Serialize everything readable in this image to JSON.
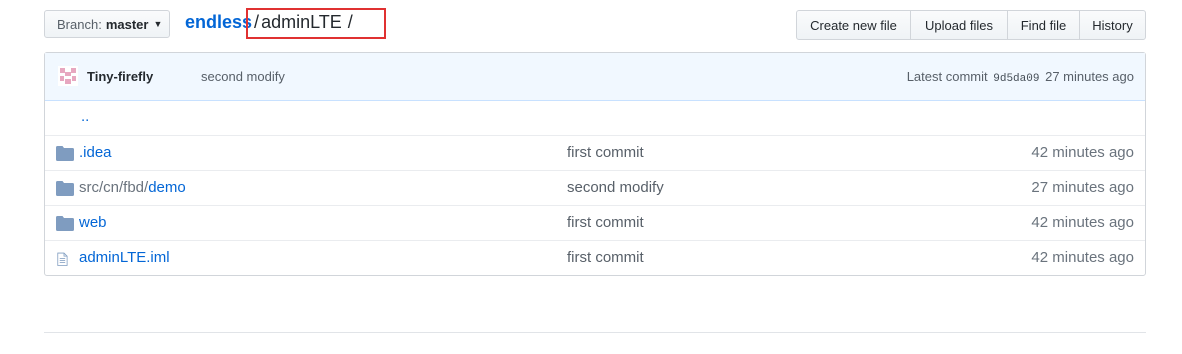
{
  "branch": {
    "prefix": "Branch:",
    "name": "master"
  },
  "breadcrumb": {
    "repo": "endless",
    "sep1": "/",
    "dir": "adminLTE",
    "sep2": "/"
  },
  "actions": [
    {
      "label": "Create new file"
    },
    {
      "label": "Upload files"
    },
    {
      "label": "Find file"
    },
    {
      "label": "History"
    }
  ],
  "commit": {
    "author": "Tiny-firefly",
    "message": "second modify",
    "latest_label": "Latest commit",
    "sha": "9d5da09",
    "age": "27 minutes ago"
  },
  "updir": "..",
  "files": [
    {
      "type": "folder",
      "name": ".idea",
      "muted": "",
      "message": "first commit",
      "age": "42 minutes ago"
    },
    {
      "type": "folder",
      "name": "demo",
      "muted": "src/cn/fbd/",
      "message": "second modify",
      "age": "27 minutes ago"
    },
    {
      "type": "folder",
      "name": "web",
      "muted": "",
      "message": "first commit",
      "age": "42 minutes ago"
    },
    {
      "type": "file",
      "name": "adminLTE.iml",
      "muted": "",
      "message": "first commit",
      "age": "42 minutes ago"
    }
  ]
}
